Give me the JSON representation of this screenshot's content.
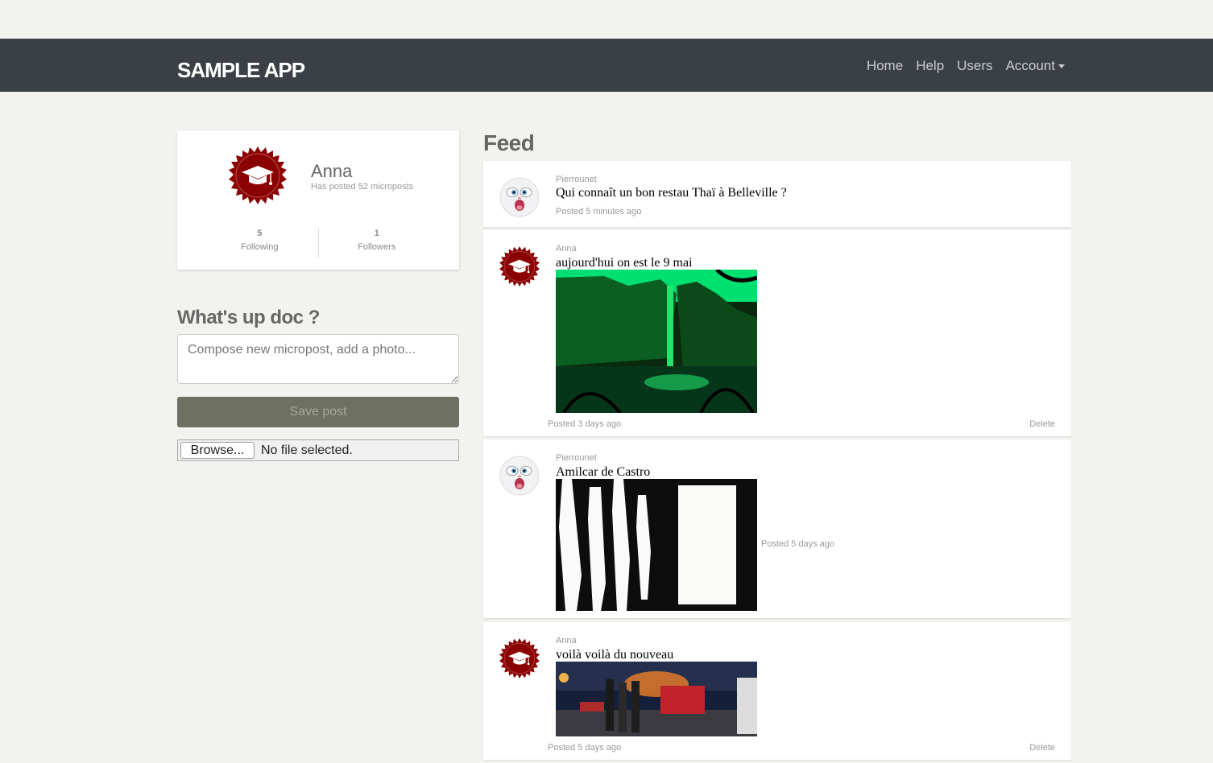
{
  "app": {
    "brand": "SAMPLE APP"
  },
  "nav": {
    "home": "Home",
    "help": "Help",
    "users": "Users",
    "account": "Account"
  },
  "profile": {
    "name": "Anna",
    "posts_text": "Has posted 52 microposts",
    "following_count": "5",
    "following_label": "Following",
    "followers_count": "1",
    "followers_label": "Followers"
  },
  "compose": {
    "title": "What's up doc ?",
    "placeholder": "Compose new micropost, add a photo...",
    "save_label": "Save post",
    "browse_label": "Browse...",
    "file_status": "No file selected."
  },
  "feed": {
    "title": "Feed",
    "posts": [
      {
        "author": "Pierrounet",
        "content": "Qui connaît un bon restau Thaï à Belleville ?",
        "time": "Posted 5 minutes ago"
      },
      {
        "author": "Anna",
        "content": "aujourd'hui on est le 9 mai",
        "time": "Posted 3 days ago",
        "delete": "Delete"
      },
      {
        "author": "Pierrounet",
        "content": "Amilcar de Castro",
        "time": "Posted 5 days ago"
      },
      {
        "author": "Anna",
        "content": "voilà voilà du nouveau",
        "time": "Posted 5 days ago",
        "delete": "Delete"
      }
    ]
  },
  "colors": {
    "navbar": "#3b4047",
    "avatar_badge": "#8b0000",
    "save_button": "#6e7062",
    "background": "#f2f2ee"
  }
}
